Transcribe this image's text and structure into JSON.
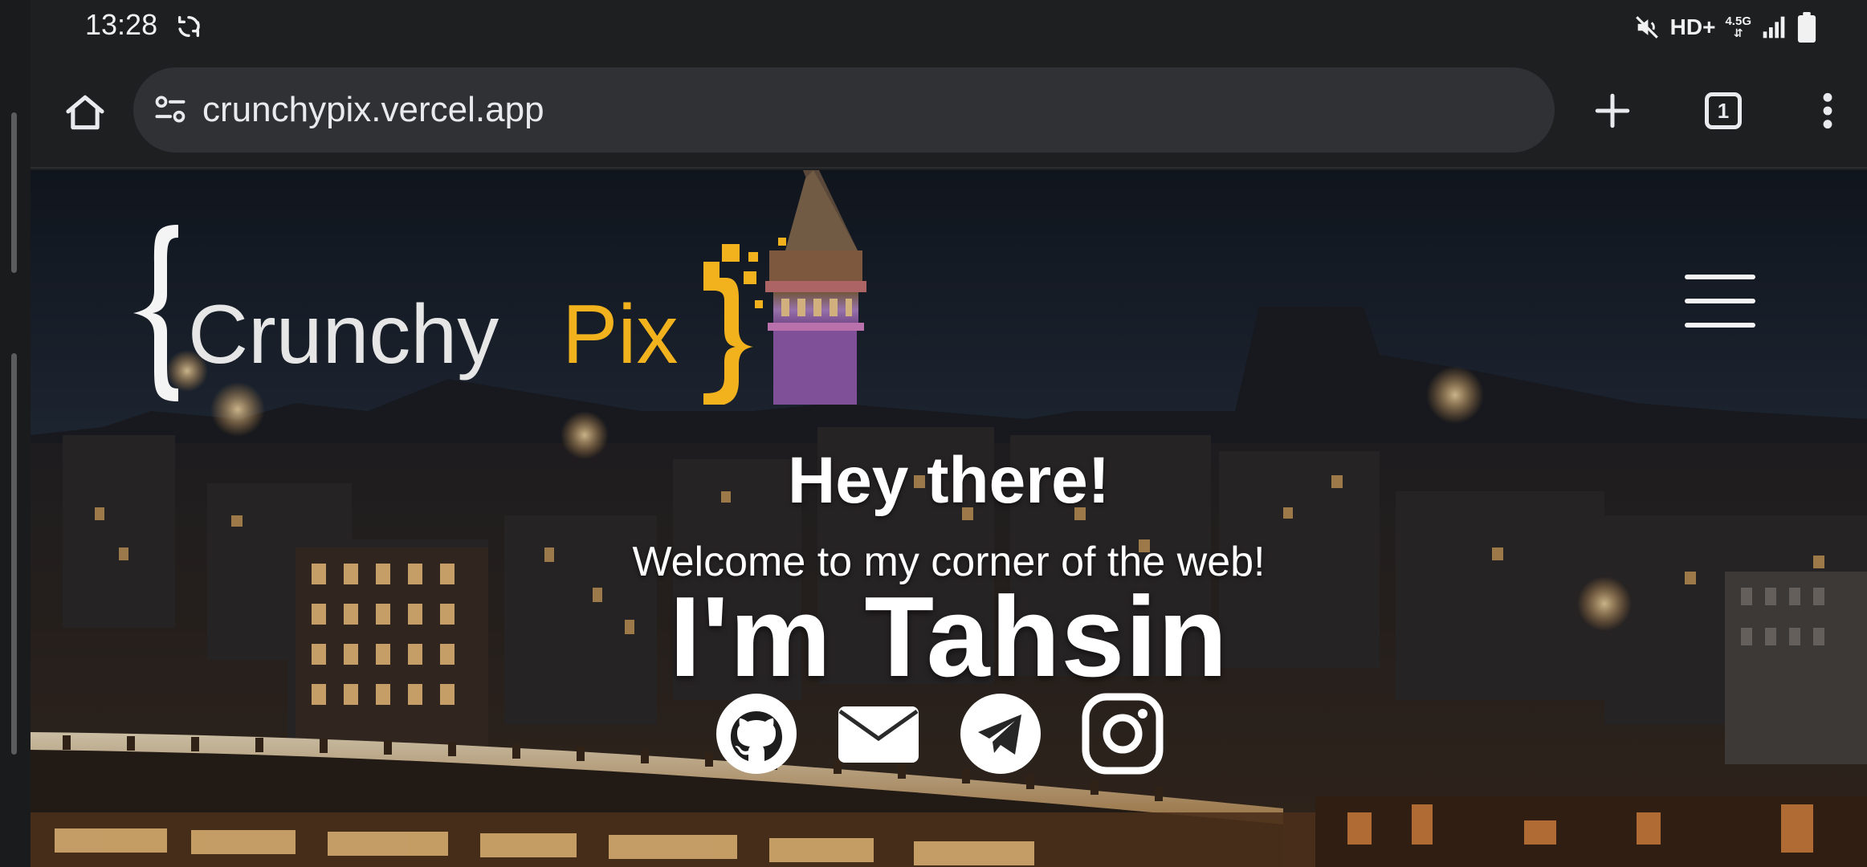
{
  "status_bar": {
    "time": "13:28",
    "network_label": "HD+",
    "network_type": "4.5G"
  },
  "browser": {
    "url": "crunchypix.vercel.app",
    "tab_count": "1"
  },
  "site": {
    "logo": {
      "part1": "Crunchy",
      "part2": "Pix",
      "accent_color": "#f2b21d"
    },
    "hero": {
      "greeting": "Hey there!",
      "welcome": "Welcome to my corner of the web!",
      "name": "I'm Tahsin"
    },
    "socials": [
      {
        "icon": "github-icon"
      },
      {
        "icon": "mail-icon"
      },
      {
        "icon": "telegram-icon"
      },
      {
        "icon": "instagram-icon"
      }
    ]
  }
}
